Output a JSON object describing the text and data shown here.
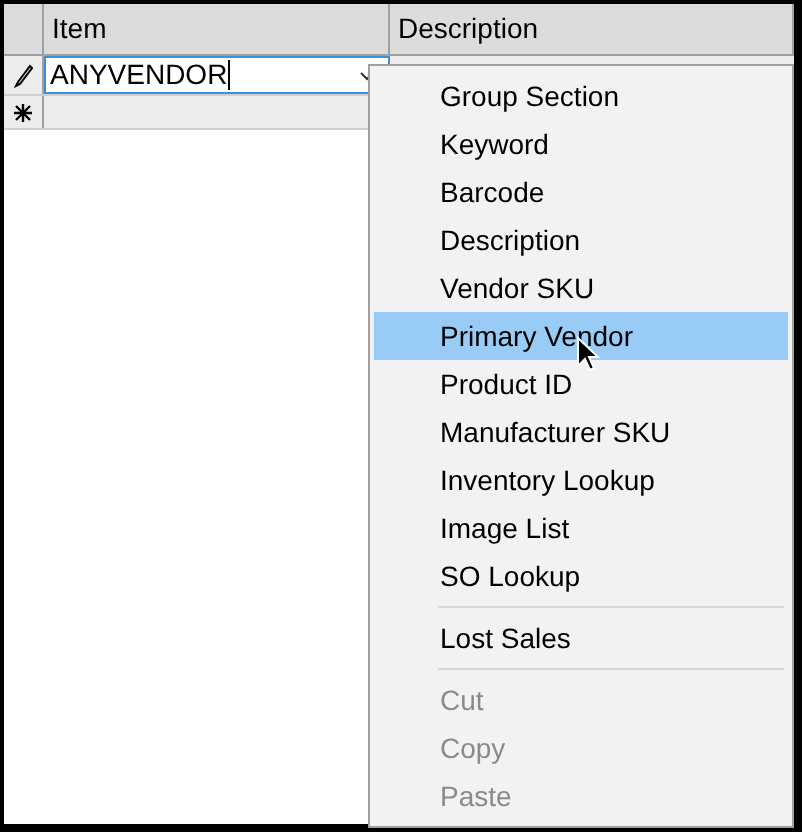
{
  "grid": {
    "columns": [
      "Item",
      "Description"
    ],
    "rows": [
      {
        "kind": "editing",
        "item": "ANYVENDOR"
      },
      {
        "kind": "new"
      }
    ]
  },
  "context_menu": {
    "items": [
      {
        "kind": "item",
        "label": "Group Section",
        "selected": false,
        "disabled": false
      },
      {
        "kind": "item",
        "label": "Keyword",
        "selected": false,
        "disabled": false
      },
      {
        "kind": "item",
        "label": "Barcode",
        "selected": false,
        "disabled": false
      },
      {
        "kind": "item",
        "label": "Description",
        "selected": false,
        "disabled": false
      },
      {
        "kind": "item",
        "label": "Vendor SKU",
        "selected": false,
        "disabled": false
      },
      {
        "kind": "item",
        "label": "Primary Vendor",
        "selected": true,
        "disabled": false
      },
      {
        "kind": "item",
        "label": "Product ID",
        "selected": false,
        "disabled": false
      },
      {
        "kind": "item",
        "label": "Manufacturer SKU",
        "selected": false,
        "disabled": false
      },
      {
        "kind": "item",
        "label": "Inventory Lookup",
        "selected": false,
        "disabled": false
      },
      {
        "kind": "item",
        "label": "Image List",
        "selected": false,
        "disabled": false
      },
      {
        "kind": "item",
        "label": "SO Lookup",
        "selected": false,
        "disabled": false
      },
      {
        "kind": "separator"
      },
      {
        "kind": "item",
        "label": "Lost Sales",
        "selected": false,
        "disabled": false
      },
      {
        "kind": "separator"
      },
      {
        "kind": "item",
        "label": "Cut",
        "selected": false,
        "disabled": true
      },
      {
        "kind": "item",
        "label": "Copy",
        "selected": false,
        "disabled": true
      },
      {
        "kind": "item",
        "label": "Paste",
        "selected": false,
        "disabled": true
      }
    ]
  }
}
